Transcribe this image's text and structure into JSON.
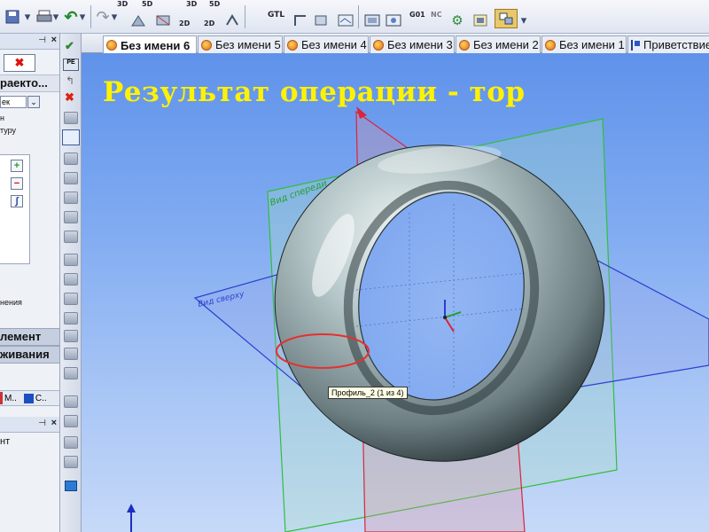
{
  "toolbar": {
    "badges": [
      "3D",
      "5D",
      "3D",
      "5D",
      "2D",
      "2D",
      "GTL",
      "G01",
      "NC"
    ],
    "icons": [
      "save-icon",
      "print-icon",
      "undo-icon",
      "redo-icon"
    ]
  },
  "left_panel": {
    "close_button": "✖",
    "section_title": "раекто...",
    "dropdown_value": "ек",
    "option_text_1": "н",
    "option_text_2": "туру",
    "add_button": "+",
    "remove_button": "−",
    "curve_button": "∫",
    "label_line": "нения",
    "element_bar": "лемент",
    "smoothing_bar": "живания",
    "bottom_tabs": [
      "М..",
      "С.."
    ],
    "bottom_text": "нт"
  },
  "tabs": [
    {
      "label": "Без имени 6",
      "active": true
    },
    {
      "label": "Без имени 5",
      "active": false
    },
    {
      "label": "Без имени 4",
      "active": false
    },
    {
      "label": "Без имени 3",
      "active": false
    },
    {
      "label": "Без имени 2",
      "active": false
    },
    {
      "label": "Без имени 1",
      "active": false
    },
    {
      "label": "Приветствие",
      "active": false
    }
  ],
  "viewport": {
    "heading": "Результат операции - тор",
    "plane_front_label": "Вид спереди",
    "plane_top_label": "Вид сверху",
    "tooltip": "Профиль_2 (1 из 4)"
  },
  "colors": {
    "heading": "#fff200",
    "front_plane": "#2fbf3a",
    "side_plane": "#d9243c",
    "top_plane": "#2a3fcf",
    "profile_circle": "#e53030",
    "torus_body": "#9fb4b8"
  }
}
